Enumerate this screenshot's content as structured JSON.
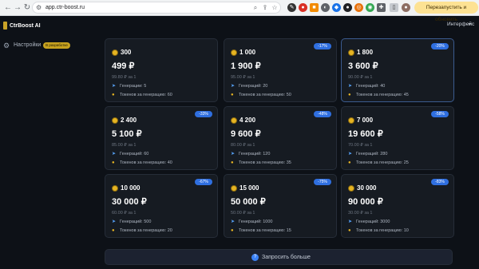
{
  "browser": {
    "url": "app.ctr-boost.ru",
    "relaunch_label": "Перезапустить и обновить"
  },
  "sidebar": {
    "app_name": "CtrBoost AI",
    "items": [
      {
        "label": "Настройки",
        "badge": "В разработке"
      }
    ]
  },
  "header": {
    "language": "Интерфейс"
  },
  "colors": {
    "background": "#0d1117",
    "card": "#161b22",
    "accent": "#2f6fe0",
    "coin": "#e6b422"
  },
  "packages": [
    {
      "tokens": "300",
      "price": "499 ₽",
      "per": "99.80 ₽ за 1",
      "gen_label": "Генерации: 5",
      "tpg_label": "Токенов за генерацию: 60",
      "discount": ""
    },
    {
      "tokens": "1 000",
      "price": "1 900 ₽",
      "per": "95.00 ₽ за 1",
      "gen_label": "Генераций: 20",
      "tpg_label": "Токенов за генерацию: 50",
      "discount": "-17%"
    },
    {
      "tokens": "1 800",
      "price": "3 600 ₽",
      "per": "90.00 ₽ за 1",
      "gen_label": "Генераций: 40",
      "tpg_label": "Токенов за генерацию: 45",
      "discount": "-20%"
    },
    {
      "tokens": "2 400",
      "price": "5 100 ₽",
      "per": "85.00 ₽ за 1",
      "gen_label": "Генераций: 60",
      "tpg_label": "Токенов за генерацию: 40",
      "discount": "-33%"
    },
    {
      "tokens": "4 200",
      "price": "9 600 ₽",
      "per": "80.00 ₽ за 1",
      "gen_label": "Генераций: 120",
      "tpg_label": "Токенов за генерацию: 35",
      "discount": "-48%"
    },
    {
      "tokens": "7 000",
      "price": "19 600 ₽",
      "per": "70.00 ₽ за 1",
      "gen_label": "Генераций: 280",
      "tpg_label": "Токенов за генерацию: 25",
      "discount": "-58%"
    },
    {
      "tokens": "10 000",
      "price": "30 000 ₽",
      "per": "60.00 ₽ за 1",
      "gen_label": "Генераций: 500",
      "tpg_label": "Токенов за генерацию: 20",
      "discount": "-67%"
    },
    {
      "tokens": "15 000",
      "price": "50 000 ₽",
      "per": "50.00 ₽ за 1",
      "gen_label": "Генераций: 1000",
      "tpg_label": "Токенов за генерацию: 15",
      "discount": "-75%"
    },
    {
      "tokens": "30 000",
      "price": "90 000 ₽",
      "per": "30.00 ₽ за 1",
      "gen_label": "Генераций: 3000",
      "tpg_label": "Токенов за генерацию: 10",
      "discount": "-83%"
    }
  ],
  "request_more_label": "Запросить больше"
}
